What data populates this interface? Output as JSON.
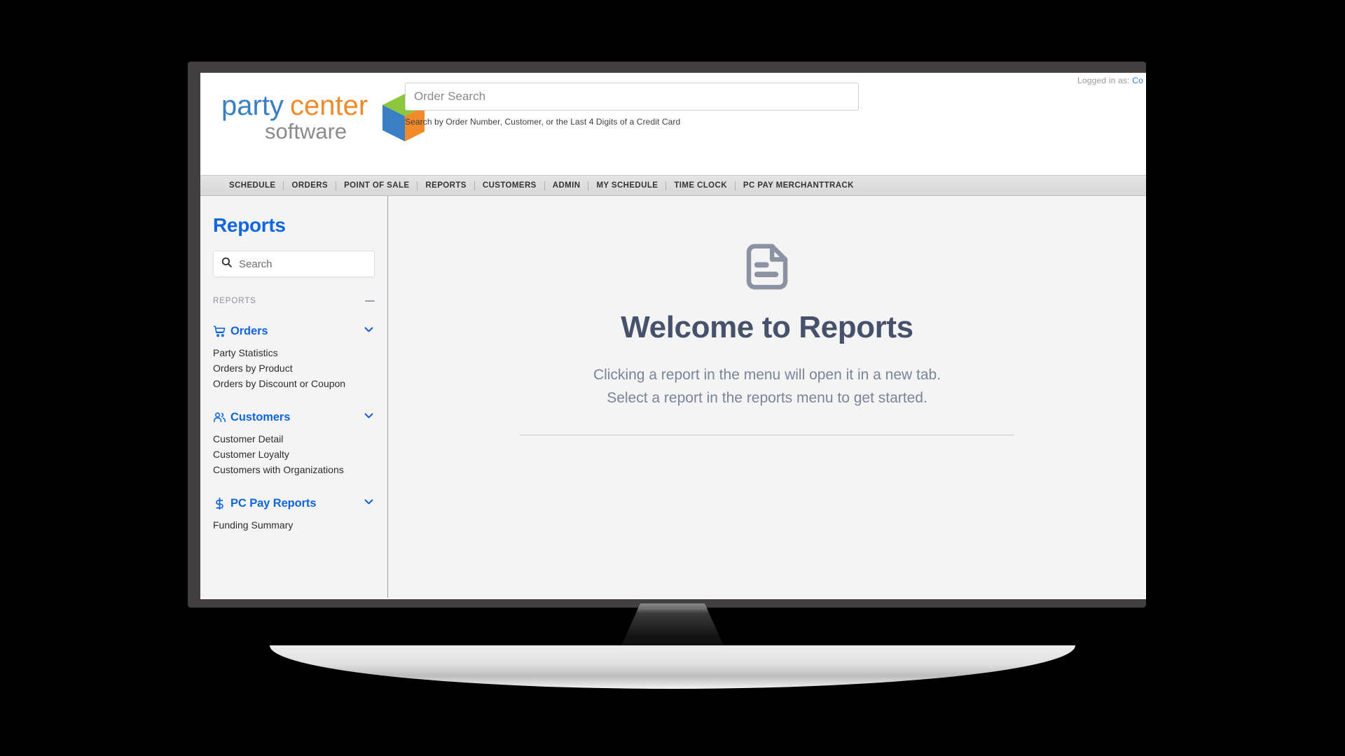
{
  "colors": {
    "brand_blue": "#1166dd",
    "logo_blue": "#3a7fc4",
    "logo_orange": "#f08a2b",
    "logo_green": "#8cc63f",
    "logo_gray": "#8b8b8b",
    "heading_slate": "#46516b",
    "body_slate": "#7b8399",
    "bezel": "#423F40",
    "nav_bar": "#d8d8d8"
  },
  "topbar": {
    "logged_in_label": "Logged in as:",
    "logged_in_user": "Co",
    "logo": {
      "word_party": "party",
      "word_center": "center",
      "word_software": "software"
    },
    "order_search": {
      "value": "",
      "placeholder": "Order Search",
      "hint": "Search by Order Number, Customer, or the Last 4 Digits of a Credit Card"
    }
  },
  "mainnav": {
    "items": [
      {
        "label": "SCHEDULE"
      },
      {
        "label": "ORDERS"
      },
      {
        "label": "POINT OF SALE"
      },
      {
        "label": "REPORTS"
      },
      {
        "label": "CUSTOMERS"
      },
      {
        "label": "ADMIN"
      },
      {
        "label": "MY SCHEDULE"
      },
      {
        "label": "TIME CLOCK"
      },
      {
        "label": "PC PAY MERCHANTTRACK"
      }
    ]
  },
  "sidebar": {
    "title": "Reports",
    "search": {
      "value": "",
      "placeholder": "Search",
      "icon": "search-icon"
    },
    "group": {
      "label": "REPORTS",
      "toggle_icon": "minus-icon"
    },
    "sections": [
      {
        "name": "Orders",
        "icon": "shopping-cart-icon",
        "chevron": "chevron-down-icon",
        "links": [
          "Party Statistics",
          "Orders by Product",
          "Orders by Discount or Coupon"
        ]
      },
      {
        "name": "Customers",
        "icon": "users-icon",
        "chevron": "chevron-down-icon",
        "links": [
          "Customer Detail",
          "Customer Loyalty",
          "Customers with Organizations"
        ]
      },
      {
        "name": "PC Pay Reports",
        "icon": "dollar-sign-icon",
        "chevron": "chevron-down-icon",
        "links": [
          "Funding Summary"
        ]
      }
    ]
  },
  "main": {
    "icon": "document-report-icon",
    "title": "Welcome to Reports",
    "line1": "Clicking a report in the menu will open it in a new tab.",
    "line2": "Select a report in the reports menu to get started."
  }
}
